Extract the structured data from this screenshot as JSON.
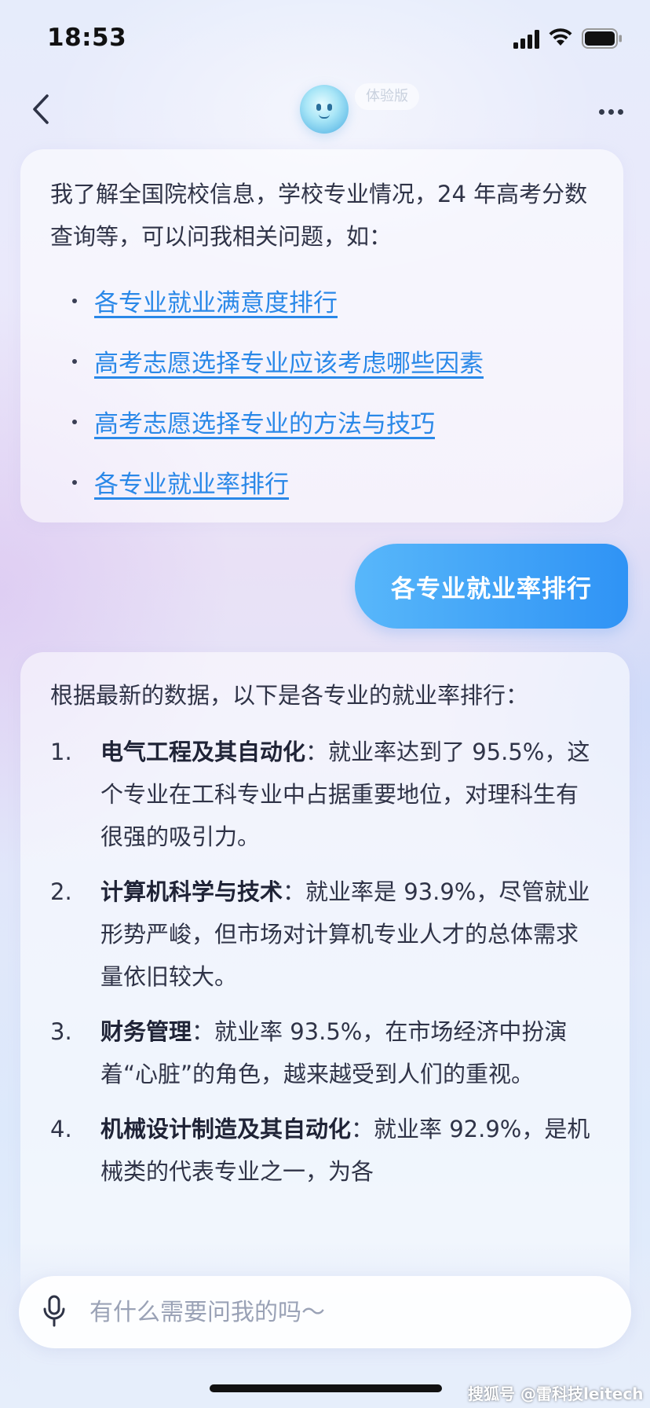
{
  "status_bar": {
    "time": "18:53"
  },
  "nav": {
    "version_badge": "体验版"
  },
  "messages": {
    "intro": {
      "text": "我了解全国院校信息，学校专业情况，24 年高考分数查询等，可以问我相关问题，如：",
      "suggestions": [
        "各专业就业满意度排行",
        "高考志愿选择专业应该考虑哪些因素",
        "高考志愿选择专业的方法与技巧",
        "各专业就业率排行"
      ]
    },
    "user_query": "各专业就业率排行",
    "answer": {
      "intro": "根据最新的数据，以下是各专业的就业率排行：",
      "items": [
        {
          "num": "1.",
          "title": "电气工程及其自动化",
          "text": "：就业率达到了 95.5%，这个专业在工科专业中占据重要地位，对理科生有很强的吸引力。"
        },
        {
          "num": "2.",
          "title": "计算机科学与技术",
          "text": "：就业率是 93.9%，尽管就业形势严峻，但市场对计算机专业人才的总体需求量依旧较大。"
        },
        {
          "num": "3.",
          "title": "财务管理",
          "text": "：就业率 93.5%，在市场经济中扮演着“心脏”的角色，越来越受到人们的重视。"
        },
        {
          "num": "4.",
          "title": "机械设计制造及其自动化",
          "text": "：就业率 92.9%，是机械类的代表专业之一，为各"
        }
      ]
    }
  },
  "input": {
    "placeholder": "有什么需要问我的吗～"
  },
  "watermark": "搜狐号 @雷科技leitech",
  "colors": {
    "accent": "#2f93f5",
    "link": "#2a88e8"
  }
}
